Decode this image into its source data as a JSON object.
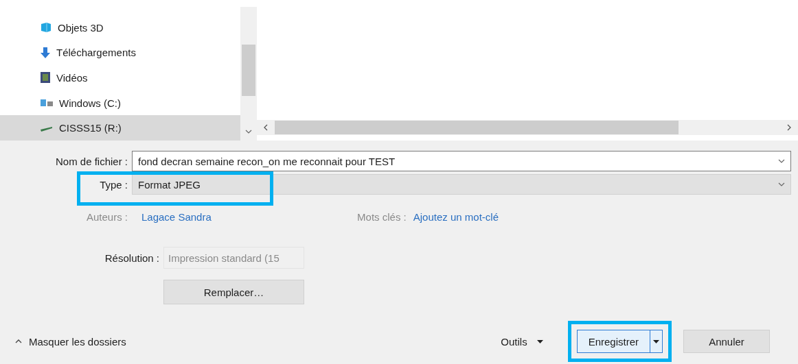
{
  "navigation": {
    "items": [
      {
        "label": "Objets 3D",
        "kind": "objects",
        "selected": false
      },
      {
        "label": "Téléchargements",
        "kind": "downloads",
        "selected": false
      },
      {
        "label": "Vidéos",
        "kind": "videos",
        "selected": false
      },
      {
        "label": "Windows (C:)",
        "kind": "system",
        "selected": false
      },
      {
        "label": "CISSS15 (R:)",
        "kind": "network",
        "selected": true
      }
    ]
  },
  "file_name": {
    "label": "Nom de fichier :",
    "value": "fond decran semaine recon_on me reconnait pour TEST"
  },
  "type": {
    "label": "Type :",
    "value": "Format JPEG",
    "highlighted": true
  },
  "authors": {
    "label": "Auteurs :",
    "value": "Lagace Sandra"
  },
  "keywords": {
    "label": "Mots clés :",
    "value": "Ajoutez un mot-clé"
  },
  "resolution": {
    "label": "Résolution :",
    "value": "Impression standard (15",
    "disabled": true
  },
  "replace_button": "Remplacer…",
  "toggle_folders": "Masquer les dossiers",
  "tools": "Outils",
  "buttons": [
    {
      "kind": "split",
      "label": "Enregistrer",
      "highlighted": true
    },
    {
      "kind": "plain",
      "label": "Annuler",
      "highlighted": false
    }
  ]
}
